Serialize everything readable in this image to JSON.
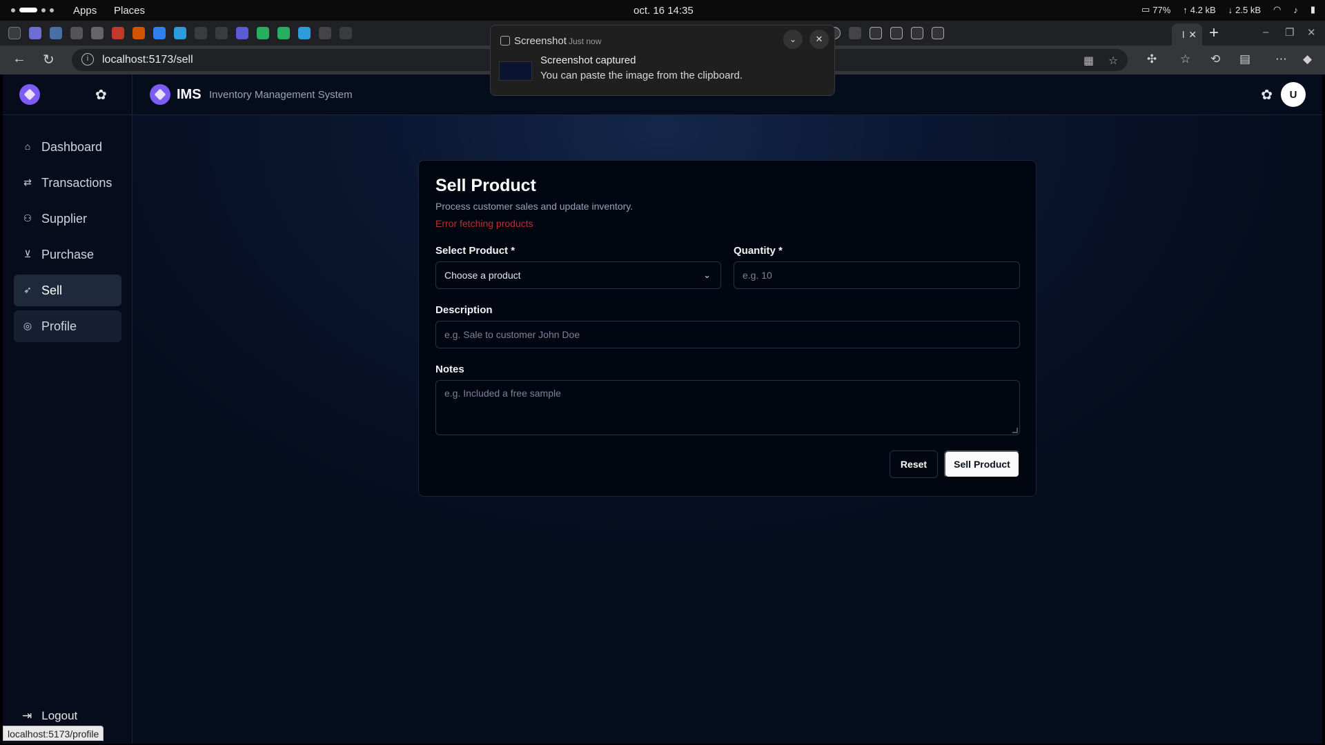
{
  "system": {
    "apps_label": "Apps",
    "places_label": "Places",
    "clock": "oct. 16  14:35",
    "battery": "77%",
    "upload": "4.2 kB",
    "download": "2.5 kB"
  },
  "browser": {
    "url": "localhost:5173/sell",
    "active_tab_glyph": "l",
    "status_url": "localhost:5173/profile"
  },
  "notification": {
    "app": "Screenshot",
    "time": "Just now",
    "title": "Screenshot captured",
    "body": "You can paste the image from the clipboard."
  },
  "app": {
    "name": "IMS",
    "subtitle": "Inventory Management System",
    "avatar_initial": "U",
    "nav": [
      {
        "label": "Dashboard",
        "icon": "home-icon"
      },
      {
        "label": "Transactions",
        "icon": "arrows-icon"
      },
      {
        "label": "Supplier",
        "icon": "users-icon"
      },
      {
        "label": "Purchase",
        "icon": "cart-icon"
      },
      {
        "label": "Sell",
        "icon": "sell-icon",
        "active": true
      },
      {
        "label": "Profile",
        "icon": "user-circle-icon"
      }
    ],
    "logout_label": "Logout"
  },
  "form": {
    "title": "Sell Product",
    "description": "Process customer sales and update inventory.",
    "error": "Error fetching products",
    "product_label": "Select Product *",
    "product_value": "Choose a product",
    "quantity_label": "Quantity *",
    "quantity_placeholder": "e.g. 10",
    "description_label": "Description",
    "description_placeholder": "e.g. Sale to customer John Doe",
    "notes_label": "Notes",
    "notes_placeholder": "e.g. Included a free sample",
    "reset_label": "Reset",
    "submit_label": "Sell Product"
  }
}
